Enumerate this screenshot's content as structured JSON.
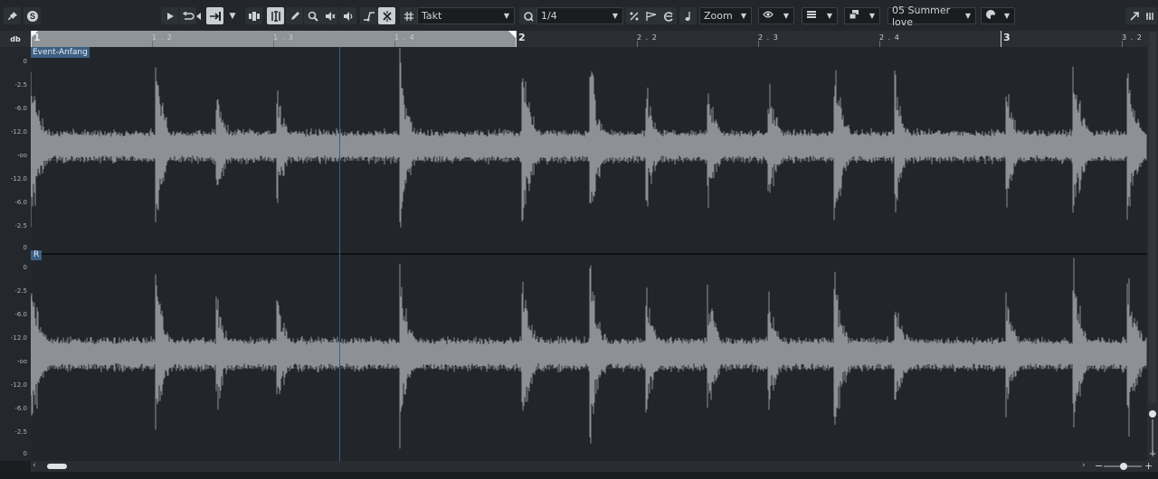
{
  "toolbar": {
    "grid_type": "Takt",
    "quantize_value": "1/4",
    "zoom_label": "Zoom",
    "track_name": "05 Summer love"
  },
  "ruler": {
    "ticks": [
      "1",
      "1.2",
      "1.3",
      "1.4",
      "2",
      "2.2",
      "2.3",
      "2.4",
      "3",
      "3.2"
    ]
  },
  "left_header": {
    "unit_label": "db",
    "db_scale": [
      "0",
      "-2.5",
      "-6.0",
      "-12.0",
      "-oo",
      "-12.0",
      "-6.0",
      "-2.5",
      "0"
    ]
  },
  "markers": {
    "event_start": "Event-Anfang",
    "right_channel": "R"
  }
}
